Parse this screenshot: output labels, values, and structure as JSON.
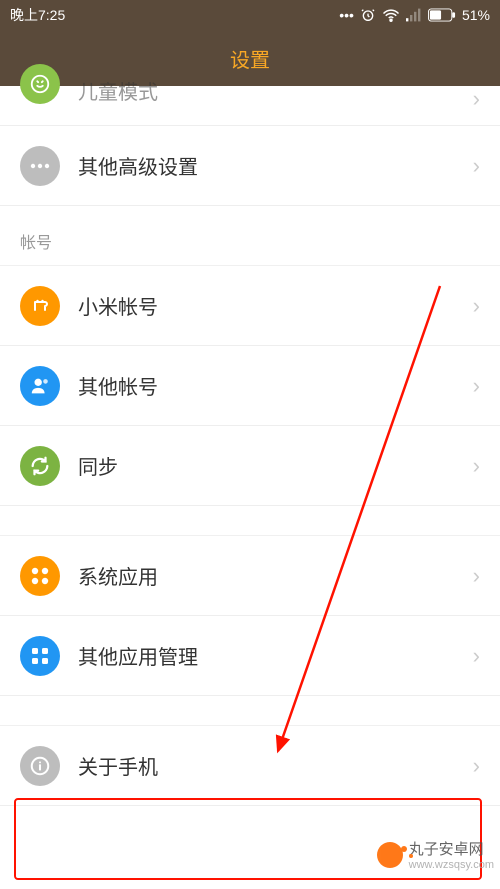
{
  "status": {
    "time": "晚上7:25",
    "battery": "51%"
  },
  "header": {
    "title": "设置"
  },
  "rows": {
    "child_mode": "儿童模式",
    "advanced": "其他高级设置",
    "section_account": "帐号",
    "mi_account": "小米帐号",
    "other_account": "其他帐号",
    "sync": "同步",
    "system_apps": "系统应用",
    "other_apps": "其他应用管理",
    "about": "关于手机"
  },
  "watermark": {
    "name": "丸子安卓网",
    "url": "www.wzsqsy.com"
  }
}
